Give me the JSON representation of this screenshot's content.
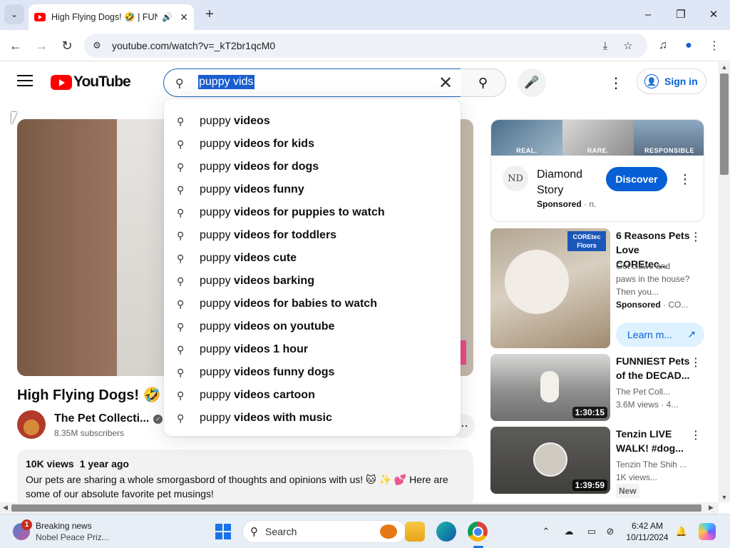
{
  "browser": {
    "tab": {
      "title": "High Flying Dogs! 🤣 | FUNNIEST",
      "audio_icon": "🔊",
      "close": "✕"
    },
    "new_tab": "+",
    "window": {
      "minimize": "–",
      "maximize": "❐",
      "close": "✕"
    },
    "url": "youtube.com/watch?v=_kT2br1qcM0",
    "icons": [
      "tab-list-icon",
      "back-icon",
      "forward-icon",
      "reload-icon",
      "site-info-icon",
      "install-icon",
      "star-icon",
      "media-icon",
      "profile-icon",
      "menu-icon"
    ]
  },
  "youtube": {
    "logo_text": "YouTube",
    "search": {
      "query": "puppy vids",
      "clear": "✕"
    },
    "sign_in": "Sign in",
    "suggestions": [
      {
        "prefix": "puppy",
        "rest": " videos"
      },
      {
        "prefix": "puppy",
        "rest": " videos for kids"
      },
      {
        "prefix": "puppy",
        "rest": " videos for dogs"
      },
      {
        "prefix": "puppy",
        "rest": " videos funny"
      },
      {
        "prefix": "puppy",
        "rest": " videos for puppies to watch"
      },
      {
        "prefix": "puppy",
        "rest": " videos for toddlers"
      },
      {
        "prefix": "puppy",
        "rest": " videos cute"
      },
      {
        "prefix": "puppy",
        "rest": " videos barking"
      },
      {
        "prefix": "puppy",
        "rest": " videos for babies to watch"
      },
      {
        "prefix": "puppy",
        "rest": " videos on youtube"
      },
      {
        "prefix": "puppy",
        "rest": " videos 1 hour"
      },
      {
        "prefix": "puppy",
        "rest": " videos funny dogs"
      },
      {
        "prefix": "puppy",
        "rest": " videos cartoon"
      },
      {
        "prefix": "puppy",
        "rest": " videos with music"
      }
    ],
    "video": {
      "title": "High Flying Dogs! 🤣 |",
      "channel": "The Pet Collecti...",
      "subscribers": "8.35M subscribers",
      "views": "10K views",
      "age": "1 year ago",
      "description": "Our pets are sharing a whole smorgasbord of thoughts and opinions with us! 🐱 ✨ 💕 Here are some of our absolute favorite pet musings!"
    },
    "ad": {
      "banner": [
        "REAL.",
        "RARE.",
        "RESPONSIBLE"
      ],
      "logo_text": "ND",
      "name": "Diamond Story",
      "sponsored": "Sponsored",
      "sponsored_suffix": " · n.",
      "cta": "Discover"
    },
    "recommendations": [
      {
        "title": "6 Reasons Pets Love COREtec...",
        "line1": "Got claws and paws in the house? Then you...",
        "line2_bold": "Sponsored",
        "line2_rest": " · CO...",
        "cta": "Learn m...",
        "brand": "COREtec Floors"
      },
      {
        "title": "FUNNIEST Pets of the DECAD...",
        "line1": "The Pet Coll...",
        "line2": "3.6M views · 4...",
        "duration": "1:30:15"
      },
      {
        "title": "Tenzin LIVE WALK! #dog...",
        "line1": "Tenzin The Shih ...",
        "line2": "1K views...",
        "badge": "New",
        "duration": "1:39:59"
      }
    ]
  },
  "taskbar": {
    "news_badge": "1",
    "news_title": "Breaking news",
    "news_sub": "Nobel Peace Priz...",
    "search_label": "Search",
    "time": "6:42 AM",
    "date": "10/11/2024"
  },
  "colors": {
    "accent": "#065fd4",
    "yt_red": "#ff0000",
    "selection": "#1a5fd0"
  }
}
